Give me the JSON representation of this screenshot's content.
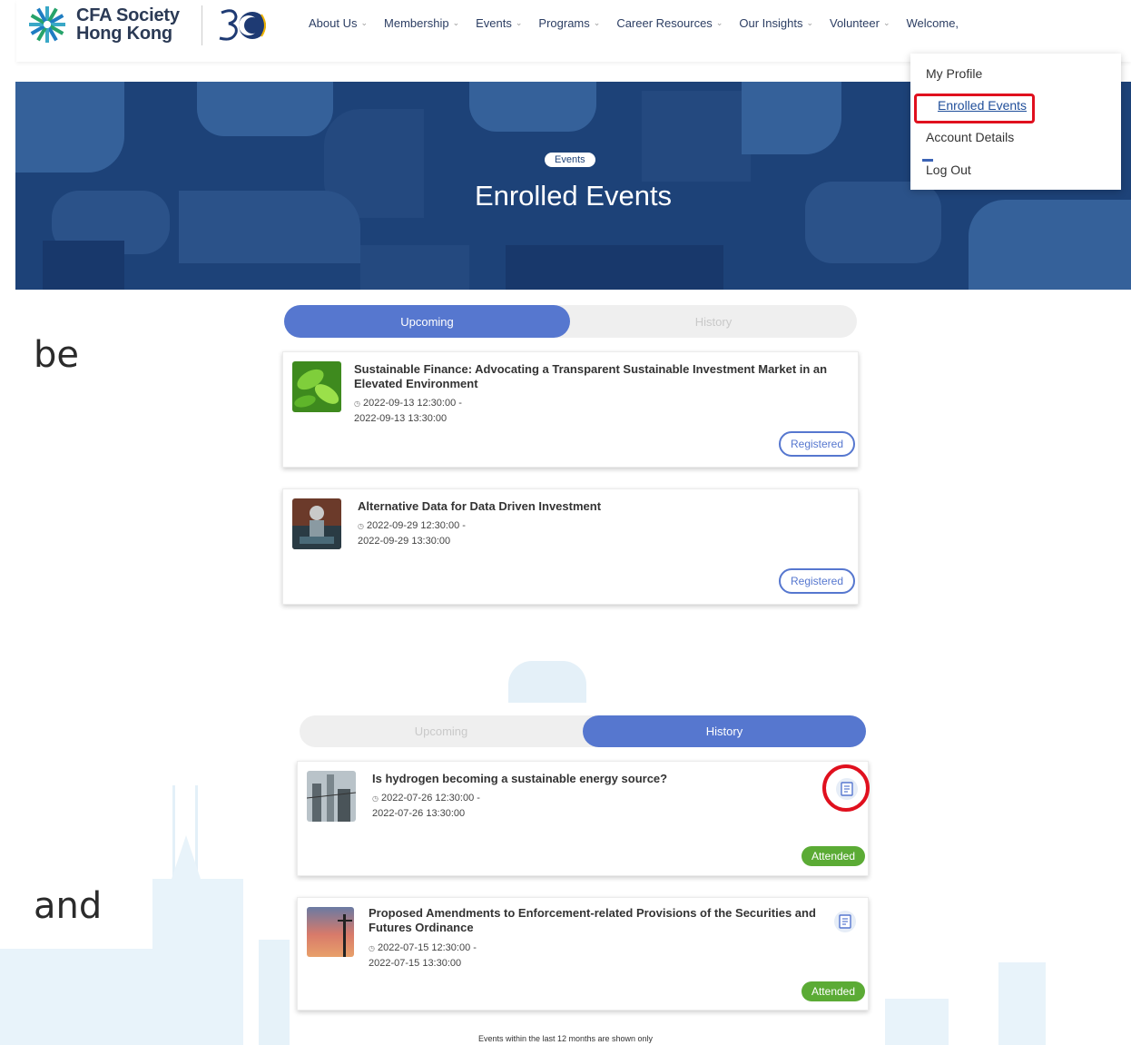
{
  "header": {
    "logo_text_line1": "CFA Society",
    "logo_text_line2": "Hong Kong",
    "nav": [
      {
        "label": "About Us"
      },
      {
        "label": "Membership"
      },
      {
        "label": "Events"
      },
      {
        "label": "Programs"
      },
      {
        "label": "Career Resources"
      },
      {
        "label": "Our Insights"
      },
      {
        "label": "Volunteer"
      }
    ],
    "welcome": "Welcome,"
  },
  "dropdown": {
    "items": [
      "My Profile",
      "Enrolled Events",
      "Account Details",
      "Log Out"
    ],
    "active": "Enrolled Events"
  },
  "banner": {
    "pill": "Events",
    "title": "Enrolled Events"
  },
  "side_text": {
    "top": "be",
    "bottom": "and"
  },
  "upcoming_view": {
    "tabs": {
      "upcoming": "Upcoming",
      "history": "History",
      "selected": "Upcoming"
    },
    "events": [
      {
        "title": "Sustainable Finance: Advocating a Transparent Sustainable Investment Market in an Elevated Environment",
        "start": "2022-09-13 12:30:00 -",
        "end": "2022-09-13 13:30:00",
        "status": "Registered"
      },
      {
        "title": "Alternative Data for Data Driven Investment",
        "start": "2022-09-29 12:30:00 -",
        "end": "2022-09-29 13:30:00",
        "status": "Registered"
      }
    ]
  },
  "history_view": {
    "tabs": {
      "upcoming": "Upcoming",
      "history": "History",
      "selected": "History"
    },
    "events": [
      {
        "title": "Is hydrogen becoming a sustainable energy source?",
        "start": "2022-07-26 12:30:00 -",
        "end": "2022-07-26 13:30:00",
        "status": "Attended"
      },
      {
        "title": "Proposed Amendments to Enforcement-related Provisions of the Securities and Futures Ordinance",
        "start": "2022-07-15 12:30:00 -",
        "end": "2022-07-15 13:30:00",
        "status": "Attended"
      }
    ],
    "footnote": "Events within the last 12 months are shown only"
  },
  "colors": {
    "accent": "#5677cf",
    "banner": "#1d4278",
    "attended": "#5bab35",
    "highlight": "#e0101e"
  }
}
